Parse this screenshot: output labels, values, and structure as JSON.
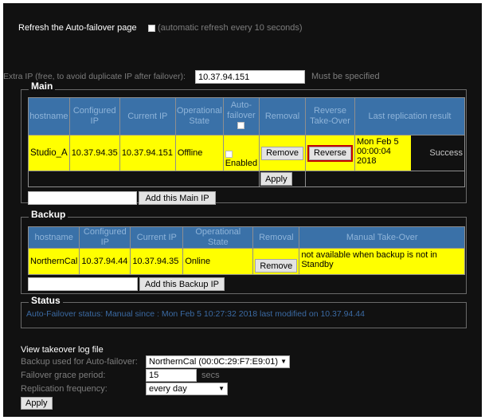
{
  "refresh": {
    "label": "Refresh the Auto-failover page",
    "note": "(automatic refresh every 10 seconds)"
  },
  "extra_ip": {
    "label": "Extra IP (free, to avoid duplicate IP after failover):",
    "value": "10.37.94.151",
    "note": "Must be specified"
  },
  "main": {
    "title": "Main",
    "headers": [
      "hostname",
      "Configured IP",
      "Current IP",
      "Operational State",
      "Auto-failover",
      "Removal",
      "Reverse Take-Over",
      "Last replication result"
    ],
    "row": {
      "hostname": "Studio_A",
      "configured_ip": "10.37.94.35",
      "current_ip": "10.37.94.151",
      "state": "Offline",
      "auto_failover": "Enabled",
      "remove_label": "Remove",
      "reverse_label": "Reverse",
      "replication_date": "Mon Feb 5 00:00:04 2018",
      "replication_result": "Success"
    },
    "apply_label": "Apply",
    "add_label": "Add this Main IP",
    "add_value": ""
  },
  "backup": {
    "title": "Backup",
    "headers": [
      "hostname",
      "Configured IP",
      "Current IP",
      "Operational State",
      "Removal",
      "Manual Take-Over"
    ],
    "row": {
      "hostname": "NorthernCal",
      "configured_ip": "10.37.94.44",
      "current_ip": "10.37.94.35",
      "state": "Online",
      "remove_label": "Remove",
      "takeover_note": "not available when backup is not in Standby"
    },
    "add_label": "Add this Backup IP",
    "add_value": ""
  },
  "status": {
    "title": "Status",
    "text": "Auto-Failover status: Manual since : Mon Feb 5 10:27:32 2018 last modified on 10.37.94.44"
  },
  "settings": {
    "log_label": "View takeover log file",
    "backup_used_label": "Backup used for Auto-failover:",
    "backup_used_value": "NorthernCal (00:0C:29:F7:E9:01)",
    "grace_label": "Failover grace period:",
    "grace_value": "15",
    "grace_unit": "secs",
    "replication_label": "Replication frequency:",
    "replication_value": "every day",
    "apply_label": "Apply"
  }
}
